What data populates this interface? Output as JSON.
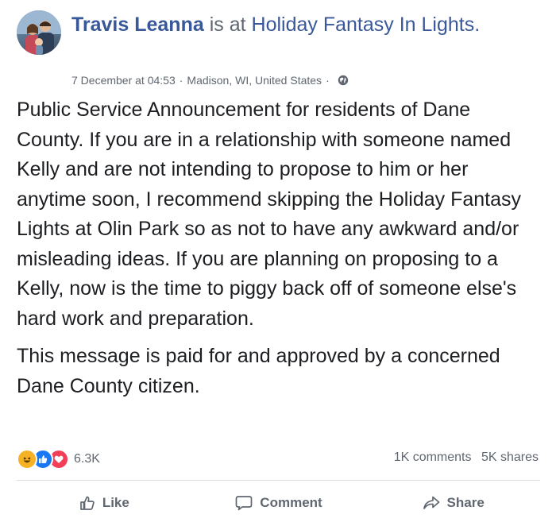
{
  "post": {
    "author": "Travis Leanna",
    "is_at": "is at",
    "place": "Holiday Fantasy In Lights.",
    "timestamp": "7 December at 04:53",
    "location": "Madison, WI, United States",
    "privacy_icon": "globe-icon",
    "paragraphs": [
      "Public Service Announcement for residents of Dane County. If you are in a relationship with someone named Kelly and are not intending to propose to him or her anytime soon, I recommend skipping the Holiday Fantasy Lights at Olin Park so as not to have any awkward and/or misleading ideas. If you are planning on proposing to a Kelly, now is the time to piggy back off of someone else's hard work and preparation.",
      "This message is paid for and approved by a concerned Dane County citizen."
    ]
  },
  "engagement": {
    "reaction_icons": [
      "haha-icon",
      "like-icon",
      "love-icon"
    ],
    "reaction_count": "6.3K",
    "comments": "1K comments",
    "shares": "5K shares"
  },
  "actions": {
    "like": "Like",
    "comment": "Comment",
    "share": "Share"
  },
  "colors": {
    "link": "#385898",
    "secondary_text": "#606770",
    "like_blue": "#1877f2",
    "love_red": "#f33e58",
    "haha_yellow": "#f7b125"
  }
}
